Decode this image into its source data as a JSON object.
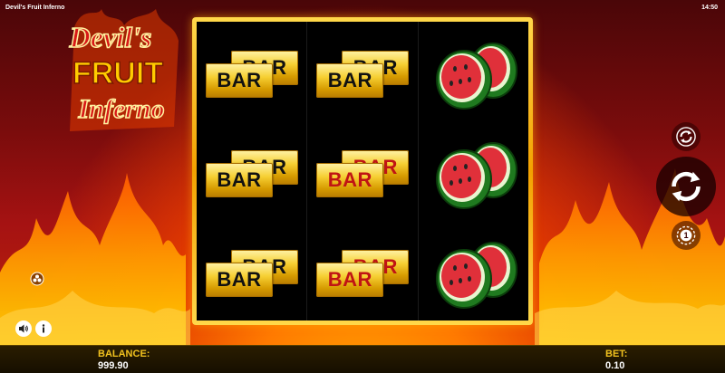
{
  "topbar": {
    "title": "Devil's Fruit Inferno",
    "clock": "14:50"
  },
  "logo": {
    "line1": "Devil's",
    "line2": "FRUIT",
    "line3": "Inferno"
  },
  "reels": [
    [
      {
        "type": "bar",
        "label": "BAR",
        "color": "black"
      },
      {
        "type": "bar",
        "label": "BAR",
        "color": "black"
      },
      {
        "type": "bar",
        "label": "BAR",
        "color": "black"
      }
    ],
    [
      {
        "type": "bar",
        "label": "BAR",
        "color": "black"
      },
      {
        "type": "bar",
        "label": "BAR",
        "color": "red"
      },
      {
        "type": "bar",
        "label": "BAR",
        "color": "red"
      }
    ],
    [
      {
        "type": "watermelon"
      },
      {
        "type": "watermelon"
      },
      {
        "type": "watermelon"
      }
    ]
  ],
  "controls": {
    "autoplay_icon": "autoplay-icon",
    "spin_icon": "spin-icon",
    "turbo_icon": "turbo-icon",
    "turbo_value": "1",
    "sound_icon": "speaker-icon",
    "info_icon": "info-icon",
    "paytable_icon": "paytable-icon"
  },
  "footer": {
    "balance_label": "BALANCE:",
    "balance_value": "999.90",
    "bet_label": "BET:",
    "bet_value": "0.10"
  },
  "colors": {
    "gold": "#f2c21e",
    "bar_red": "#c01414",
    "frame": "#f3a100",
    "background": "#7a0a0a"
  }
}
